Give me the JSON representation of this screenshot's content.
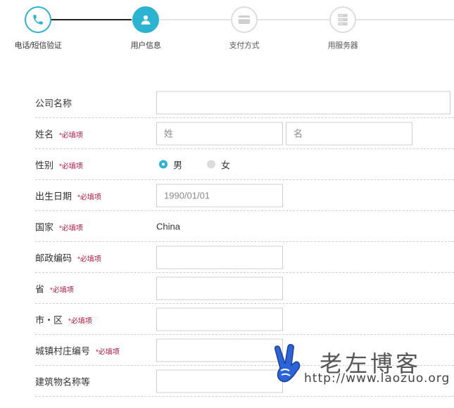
{
  "stepper": {
    "steps": [
      {
        "label": "电话/短信验证",
        "icon": "phone-icon",
        "state": "done"
      },
      {
        "label": "用户信息",
        "icon": "user-icon",
        "state": "active"
      },
      {
        "label": "支付方式",
        "icon": "card-icon",
        "state": "pending"
      },
      {
        "label": "用服务器",
        "icon": "server-icon",
        "state": "pending"
      }
    ],
    "colors": {
      "active": "#2bb3d1",
      "done_line": "#222222",
      "pending": "#d7d7d7"
    }
  },
  "form": {
    "required_text": "*必填项",
    "company": {
      "label": "公司名称",
      "value": ""
    },
    "name": {
      "label": "姓名",
      "last_placeholder": "姓",
      "first_placeholder": "名"
    },
    "gender": {
      "label": "性别",
      "options": [
        "男",
        "女"
      ],
      "selected": "男"
    },
    "birthdate": {
      "label": "出生日期",
      "placeholder": "1990/01/01"
    },
    "country": {
      "label": "国家",
      "value": "China"
    },
    "postal": {
      "label": "邮政编码",
      "value": ""
    },
    "province": {
      "label": "省",
      "value": ""
    },
    "city": {
      "label": "市・区",
      "value": ""
    },
    "town": {
      "label": "城镇村庄编号",
      "value": ""
    },
    "building": {
      "label": "建筑物名称等",
      "value": ""
    }
  },
  "watermark": {
    "title": "老左博客",
    "url": "http://www.laozuo.org"
  }
}
